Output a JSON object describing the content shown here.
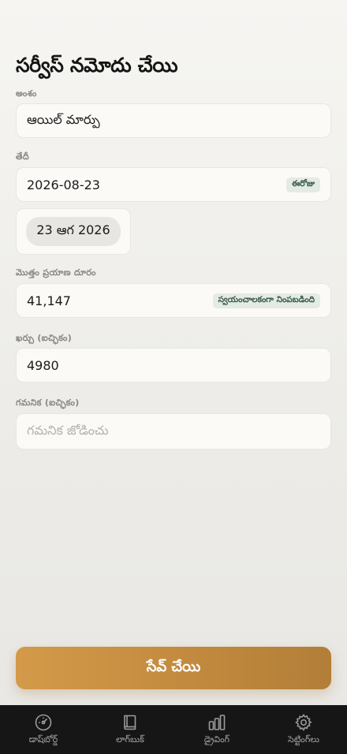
{
  "page": {
    "title": "సర్వీస్ నమోదు చేయి"
  },
  "form": {
    "item": {
      "label": "అంశం",
      "value": "ఆయిల్ మార్పు"
    },
    "date": {
      "label": "తేదీ",
      "value": "2026-08-23",
      "today_badge": "ఈరోజు",
      "chip": "23 ఆగ 2026"
    },
    "odometer": {
      "label": "మొత్తం ప్రయాణ దూరం",
      "value": "41,147",
      "badge": "స్వయంచాలకంగా నింపబడింది"
    },
    "cost": {
      "label": "ఖర్చు (ఐచ్ఛికం)",
      "value": "4980"
    },
    "note": {
      "label": "గమనిక (ఐచ్ఛికం)",
      "placeholder": "గమనిక జోడించు"
    }
  },
  "actions": {
    "save_label": "సేవ్ చేయి",
    "accent": "#c8913f"
  },
  "tabbar": {
    "items": [
      {
        "label": "డాష్‌బోర్డ్",
        "icon": "speedometer-icon"
      },
      {
        "label": "లాగ్‌బుక్",
        "icon": "book-icon"
      },
      {
        "label": "డ్రైవింగ్",
        "icon": "bar-chart-icon"
      },
      {
        "label": "సెట్టింగ్‌లు",
        "icon": "gear-icon"
      }
    ]
  }
}
